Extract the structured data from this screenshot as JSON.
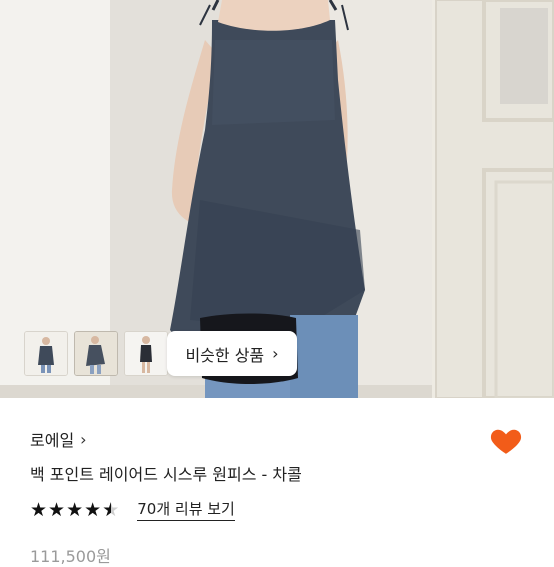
{
  "hero": {
    "similar_button_label": "비슷한 상품",
    "thumbnails": [
      "thumb-1",
      "thumb-2",
      "thumb-3"
    ]
  },
  "product": {
    "brand": "로에일",
    "title": "백 포인트 레이어드 시스루 원피스 - 차콜",
    "rating_stars": 4.5,
    "review_link": "70개 리뷰 보기",
    "price": "111,500원"
  },
  "colors": {
    "heart": "#f25c19",
    "dress": "#3f4a5a"
  },
  "icons": {
    "heart": "heart-icon",
    "chevron": "chevron-right-icon"
  }
}
